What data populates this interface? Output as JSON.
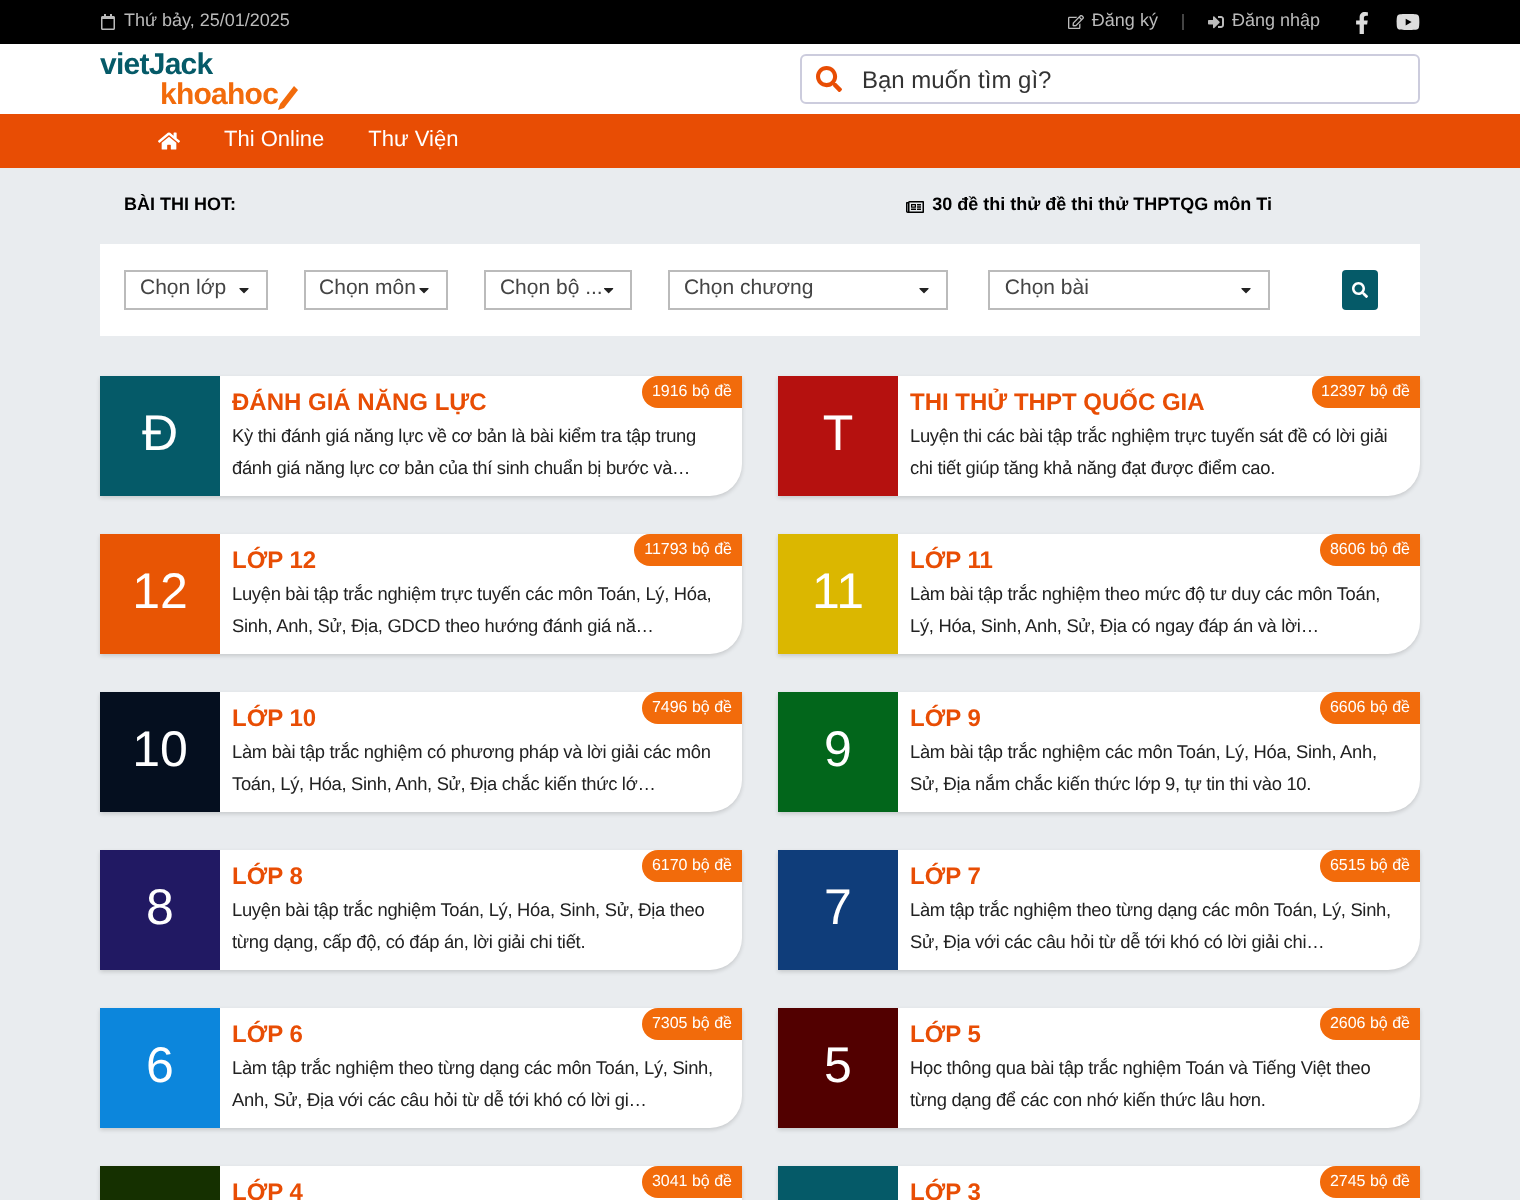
{
  "top_bar": {
    "date": "Thứ bảy, 25/01/2025",
    "register": "Đăng ký",
    "login": "Đăng nhập"
  },
  "logo": {
    "line1": "vietJack",
    "line2": "khoahoc"
  },
  "search": {
    "placeholder": "Bạn muốn tìm gì?"
  },
  "nav": {
    "items": [
      {
        "label": "Thi Online"
      },
      {
        "label": "Thư Viện"
      }
    ]
  },
  "hot": {
    "label": "BÀI THI HOT:",
    "ticker": "30 đề thi thử đề thi thử THPTQG môn Ti"
  },
  "filters": [
    {
      "label": "Chọn lớp"
    },
    {
      "label": "Chọn môn"
    },
    {
      "label": "Chọn bộ ..."
    },
    {
      "label": "Chọn chương"
    },
    {
      "label": "Chọn bài"
    }
  ],
  "cards": [
    {
      "tile": "Đ",
      "color": "#055a68",
      "title": "ĐÁNH GIÁ NĂNG LỰC",
      "count": "1916 bộ đề",
      "desc": "Kỳ thi đánh giá năng lực về cơ bản là bài kiểm tra tập trung đánh giá năng lực cơ bản của thí sinh chuẩn bị bước và…"
    },
    {
      "tile": "T",
      "color": "#b5110f",
      "title": "THI THỬ THPT QUỐC GIA",
      "count": "12397 bộ đề",
      "desc": "Luyện thi các bài tập trắc nghiệm trực tuyến sát đề có lời giải chi tiết giúp tăng khả năng đạt được điểm cao."
    },
    {
      "tile": "12",
      "color": "#e85504",
      "title": "LỚP 12",
      "count": "11793 bộ đề",
      "desc": "Luyện bài tập trắc nghiệm trực tuyến các môn Toán, Lý, Hóa, Sinh, Anh, Sử, Địa, GDCD theo hướng đánh giá nă…"
    },
    {
      "tile": "11",
      "color": "#dbb700",
      "title": "LỚP 11",
      "count": "8606 bộ đề",
      "desc": "Làm bài tập trắc nghiệm theo mức độ tư duy các môn Toán, Lý, Hóa, Sinh, Anh, Sử, Địa có ngay đáp án và lời…"
    },
    {
      "tile": "10",
      "color": "#050f1f",
      "title": "LỚP 10",
      "count": "7496 bộ đề",
      "desc": "Làm bài tập trắc nghiệm có phương pháp và lời giải các môn Toán, Lý, Hóa, Sinh, Anh, Sử, Địa chắc kiến thức lớ…"
    },
    {
      "tile": "9",
      "color": "#02661b",
      "title": "LỚP 9",
      "count": "6606 bộ đề",
      "desc": "Làm bài tập trắc nghiệm các môn Toán, Lý, Hóa, Sinh, Anh, Sử, Địa nắm chắc kiến thức lớp 9, tự tin thi vào 10."
    },
    {
      "tile": "8",
      "color": "#211963",
      "title": "LỚP 8",
      "count": "6170 bộ đề",
      "desc": "Luyện bài tập trắc nghiệm Toán, Lý, Hóa, Sinh, Sử, Địa theo từng dạng, cấp độ, có đáp án, lời giải chi tiết."
    },
    {
      "tile": "7",
      "color": "#0f3d7a",
      "title": "LỚP 7",
      "count": "6515 bộ đề",
      "desc": "Làm tập trắc nghiệm theo từng dạng các môn Toán, Lý, Sinh, Sử, Địa với các câu hỏi từ dễ tới khó có lời giải chi…"
    },
    {
      "tile": "6",
      "color": "#0c86dc",
      "title": "LỚP 6",
      "count": "7305 bộ đề",
      "desc": "Làm tập trắc nghiệm theo từng dạng các môn Toán, Lý, Sinh, Anh, Sử, Địa với các câu hỏi từ dễ tới khó có lời gi…"
    },
    {
      "tile": "5",
      "color": "#520000",
      "title": "LỚP 5",
      "count": "2606 bộ đề",
      "desc": "Học thông qua bài tập trắc nghiệm Toán và Tiếng Việt theo từng dạng để các con nhớ kiến thức lâu hơn."
    },
    {
      "color": "#153000",
      "title": "LỚP 4",
      "count": "3041 bộ đề"
    },
    {
      "color": "#055a68",
      "title": "LỚP 3",
      "count": "2745 bộ đề"
    }
  ]
}
